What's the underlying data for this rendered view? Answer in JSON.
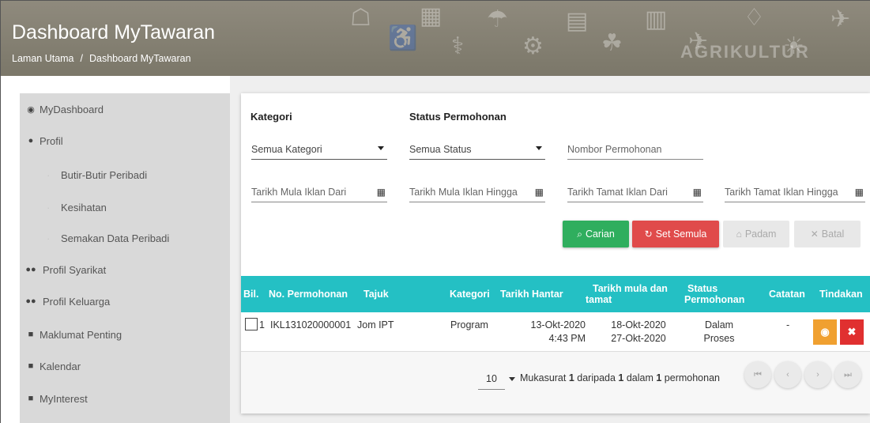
{
  "header": {
    "title": "Dashboard MyTawaran",
    "breadcrumb": [
      "Laman Utama",
      "Dashboard MyTawaran"
    ],
    "watermark": "AGRIKULTUR"
  },
  "sidebar": {
    "items": [
      {
        "label": "MyDashboard",
        "icon": "dashboard-icon"
      },
      {
        "label": "Profil",
        "icon": "user-icon"
      },
      {
        "label": "Butir-Butir Peribadi",
        "icon": ""
      },
      {
        "label": "Kesihatan",
        "icon": ""
      },
      {
        "label": "Semakan Data Peribadi",
        "icon": ""
      },
      {
        "label": "Profil Syarikat",
        "icon": "users-icon"
      },
      {
        "label": "Profil Keluarga",
        "icon": "users-icon"
      },
      {
        "label": "Maklumat Penting",
        "icon": "file-icon"
      },
      {
        "label": "Kalendar",
        "icon": "file-icon"
      },
      {
        "label": "MyInterest",
        "icon": "file-icon"
      }
    ]
  },
  "filters": {
    "kategori_label": "Kategori",
    "status_label": "Status Permohonan",
    "kategori_value": "Semua Kategori",
    "status_value": "Semua Status",
    "nombor_placeholder": "Nombor Permohonan",
    "tarikh_mula_dari": "Tarikh Mula Iklan Dari",
    "tarikh_mula_hingga": "Tarikh Mula Iklan Hingga",
    "tarikh_tamat_dari": "Tarikh Tamat Iklan Dari",
    "tarikh_tamat_hingga": "Tarikh Tamat Iklan Hingga"
  },
  "buttons": {
    "carian": "Carian",
    "set_semula": "Set Semula",
    "padam": "Padam",
    "batal": "Batal"
  },
  "table": {
    "headers": {
      "bil": "Bil.",
      "no": "No. Permohonan",
      "tajuk": "Tajuk",
      "kategori": "Kategori",
      "hantar": "Tarikh Hantar",
      "mula_tamat_1": "Tarikh mula dan",
      "mula_tamat_2": "tamat",
      "status_1": "Status",
      "status_2": "Permohonan",
      "catatan": "Catatan",
      "tindakan": "Tindakan"
    },
    "rows": [
      {
        "bil": "1",
        "no": "IKL131020000001",
        "tajuk": "Jom IPT",
        "kategori": "Program",
        "hantar_date": "13-Okt-2020",
        "hantar_time": "4:43 PM",
        "mula": "18-Okt-2020",
        "tamat": "27-Okt-2020",
        "status_1": "Dalam",
        "status_2": "Proses",
        "catatan": "-"
      }
    ]
  },
  "pagination": {
    "per_page": "10",
    "text_a": "Mukasurat ",
    "page": "1",
    "text_b": " daripada ",
    "total_pages": "1",
    "text_c": " dalam ",
    "total_items": "1",
    "text_d": " permohonan"
  },
  "colors": {
    "table_header": "#24c0c4",
    "search": "#2fae5e",
    "reset": "#e04b4b",
    "view": "#f0a030",
    "delete": "#e03030"
  }
}
